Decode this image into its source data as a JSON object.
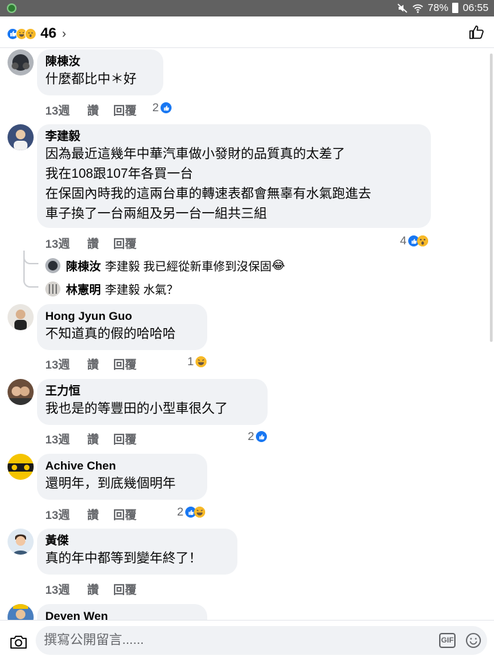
{
  "status_bar": {
    "battery_percent": "78%",
    "time": "06:55"
  },
  "header": {
    "reaction_count": "46",
    "reaction_icons": [
      "like",
      "haha",
      "wow"
    ],
    "chevron": "›"
  },
  "comments": [
    {
      "name": "陳棟汝",
      "lines": [
        "什麼都比中＊好"
      ],
      "time": "13週",
      "like_label": "讚",
      "reply_label": "回覆",
      "reaction_count": "2",
      "reactions": [
        "like"
      ]
    },
    {
      "name": "李建毅",
      "lines": [
        "因為最近這幾年中華汽車做小發財的品質真的太差了",
        "我在108跟107年各買一台",
        "在保固內時我的這兩台車的轉速表都會無辜有水氣跑進去",
        "車子換了一台兩組及另一台一組共三組"
      ],
      "time": "13週",
      "like_label": "讚",
      "reply_label": "回覆",
      "reaction_count": "4",
      "reactions": [
        "like",
        "wow"
      ],
      "replies": [
        {
          "name": "陳棟汝",
          "text": "李建毅 我已經從新車修到沒保固",
          "emoji": "😂"
        },
        {
          "name": "林憲明",
          "text": "李建毅 水氣？",
          "emoji": ""
        }
      ]
    },
    {
      "name": "Hong Jyun Guo",
      "lines": [
        "不知道真的假的哈哈哈"
      ],
      "time": "13週",
      "like_label": "讚",
      "reply_label": "回覆",
      "reaction_count": "1",
      "reactions": [
        "haha"
      ]
    },
    {
      "name": "王力恒",
      "lines": [
        "我也是的等豐田的小型車很久了"
      ],
      "time": "13週",
      "like_label": "讚",
      "reply_label": "回覆",
      "reaction_count": "2",
      "reactions": [
        "like"
      ]
    },
    {
      "name": "Achive Chen",
      "lines": [
        "還明年，到底幾個明年"
      ],
      "time": "13週",
      "like_label": "讚",
      "reply_label": "回覆",
      "reaction_count": "2",
      "reactions": [
        "like",
        "haha"
      ]
    },
    {
      "name": "黃傑",
      "lines": [
        "真的年中都等到變年終了！"
      ],
      "time": "13週",
      "like_label": "讚",
      "reply_label": "回覆",
      "reaction_count": "",
      "reactions": []
    },
    {
      "name": "Deven Wen",
      "lines": [],
      "time": "",
      "like_label": "",
      "reply_label": "",
      "reaction_count": "",
      "reactions": []
    }
  ],
  "composer": {
    "placeholder": "撰寫公開留言......",
    "gif_label": "GIF"
  },
  "colors": {
    "like_blue": "#1877f2",
    "emoji_yellow": "#f7b928",
    "bubble_gray": "#f0f2f5",
    "meta_gray": "#65676b"
  }
}
